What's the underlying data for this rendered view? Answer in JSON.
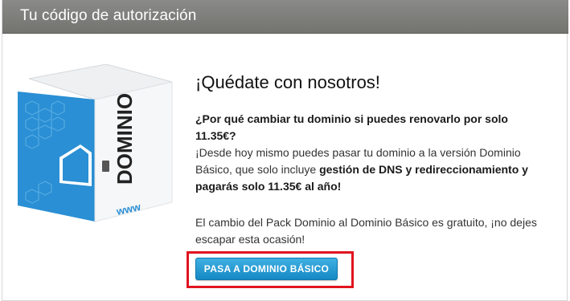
{
  "header": {
    "title": "Tu código de autorización"
  },
  "content": {
    "headline": "¡Quédate con nosotros!",
    "question": "¿Por qué cambiar tu dominio si puedes renovarlo por solo 11.35€?",
    "body_intro": "¡Desde hoy mismo puedes pasar tu dominio a la versión Dominio Básico, que solo incluye ",
    "body_bold": "gestión de DNS y redireccionamiento y pagarás solo 11.35€ al año!",
    "note": "El cambio del Pack Dominio al Dominio Básico es gratuito, ¡no dejes escapar esta ocasión!"
  },
  "illustration": {
    "box_label": "DOMINIO",
    "box_label_small": "www"
  },
  "cta": {
    "label": "PASA A DOMINIO BÁSICO"
  },
  "colors": {
    "header": "#7e7e7b",
    "button": "#1e95cf",
    "highlight": "#e0141e",
    "box_blue": "#2a8fd4"
  }
}
